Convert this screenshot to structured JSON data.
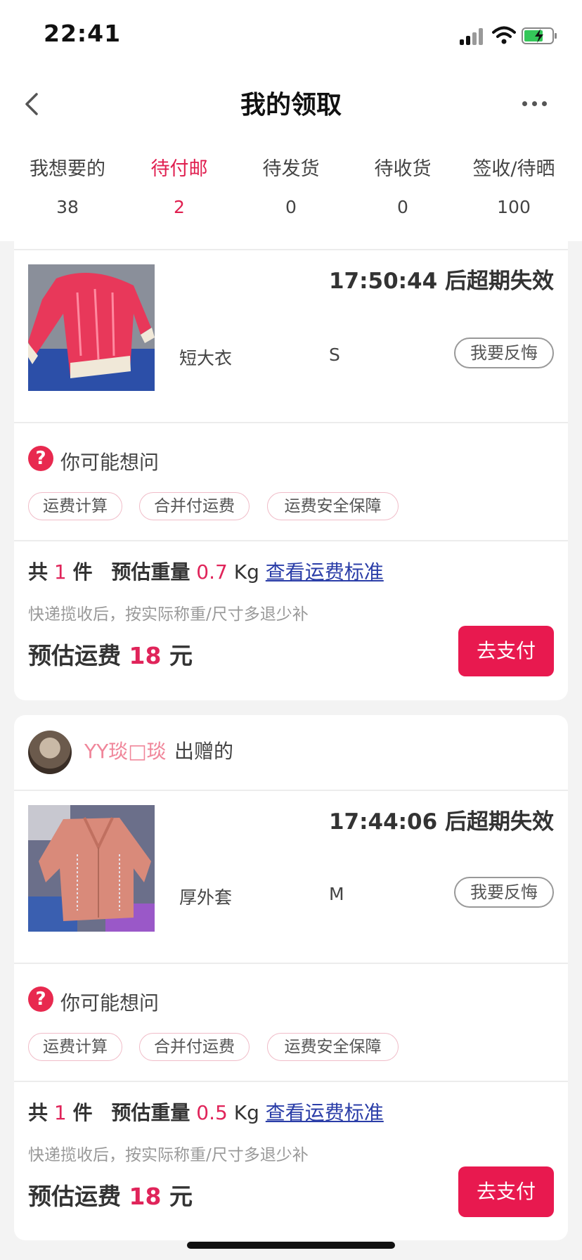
{
  "status_bar": {
    "time": "22:41"
  },
  "nav": {
    "title": "我的领取"
  },
  "tabs": [
    {
      "label": "我想要的",
      "count": "38"
    },
    {
      "label": "待付邮",
      "count": "2",
      "active": true
    },
    {
      "label": "待发货",
      "count": "0"
    },
    {
      "label": "待收货",
      "count": "0"
    },
    {
      "label": "签收/待晒",
      "count": "100"
    }
  ],
  "colors": {
    "accent": "#e8194f",
    "link": "#2b3ea8",
    "seller": "#f0869a"
  },
  "orders": [
    {
      "countdown": "17:50:44 后超期失效",
      "product_name": "短大衣",
      "size": "S",
      "regret_label": "我要反悔",
      "faq_title": "你可能想问",
      "faq_icon": "?",
      "chips": [
        "运费计算",
        "合并付运费",
        "运费安全保障"
      ],
      "summary": {
        "total_prefix": "共",
        "count": "1",
        "unit": "件",
        "weight_label": "预估重量",
        "weight": "0.7",
        "weight_unit": "Kg",
        "rule_link": "查看运费标准"
      },
      "hint": "快递揽收后，按实际称重/尺寸多退少补",
      "fee": {
        "label": "预估运费",
        "amount": "18",
        "unit": "元"
      },
      "pay_label": "去支付"
    },
    {
      "seller": {
        "name": "YY琰□琰",
        "suffix": "出赠的"
      },
      "countdown": "17:44:06 后超期失效",
      "product_name": "厚外套",
      "size": "M",
      "regret_label": "我要反悔",
      "faq_title": "你可能想问",
      "faq_icon": "?",
      "chips": [
        "运费计算",
        "合并付运费",
        "运费安全保障"
      ],
      "summary": {
        "total_prefix": "共",
        "count": "1",
        "unit": "件",
        "weight_label": "预估重量",
        "weight": "0.5",
        "weight_unit": "Kg",
        "rule_link": "查看运费标准"
      },
      "hint": "快递揽收后，按实际称重/尺寸多退少补",
      "fee": {
        "label": "预估运费",
        "amount": "18",
        "unit": "元"
      },
      "pay_label": "去支付"
    }
  ]
}
